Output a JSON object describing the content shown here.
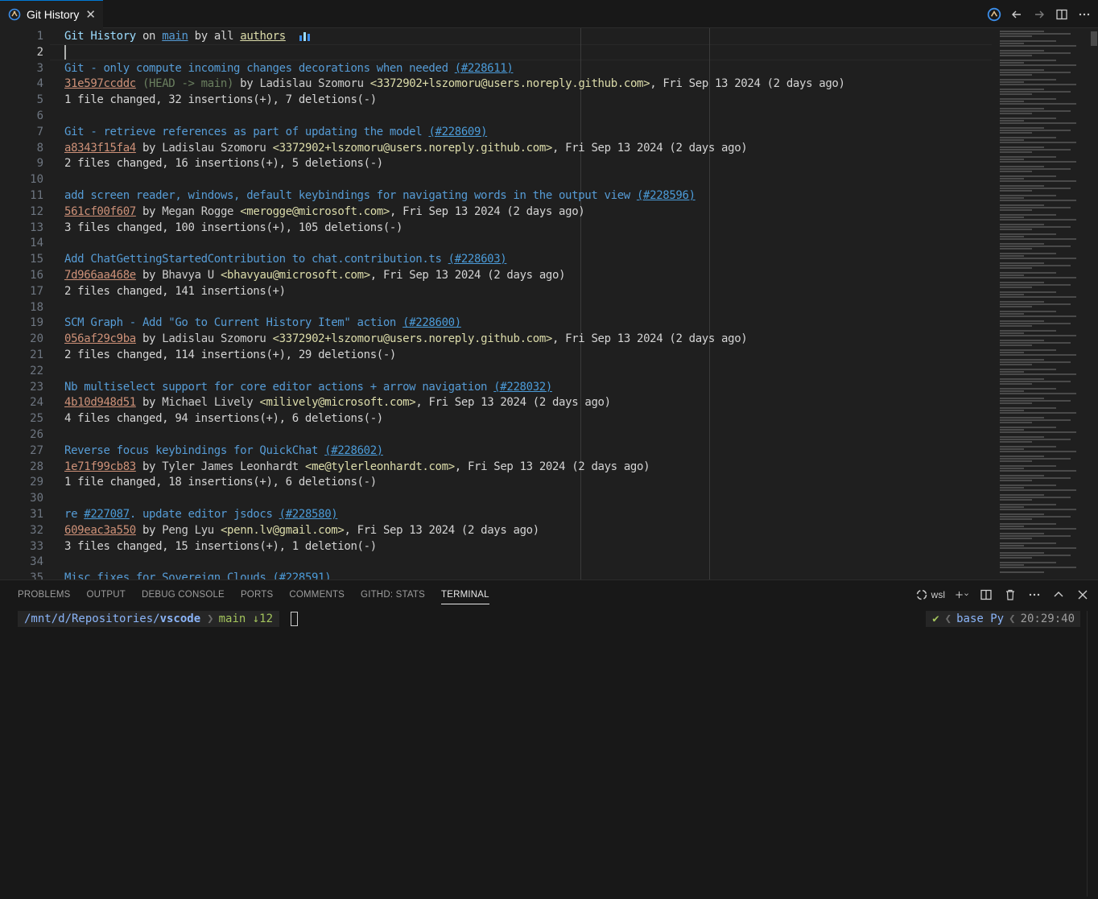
{
  "tab": {
    "title": "Git History",
    "close_glyph": "✕",
    "icon": "git-history-icon"
  },
  "editor": {
    "line_numbers": [
      "1",
      "2",
      "3",
      "4",
      "5",
      "6",
      "7",
      "8",
      "9",
      "10",
      "11",
      "12",
      "13",
      "14",
      "15",
      "16",
      "17",
      "18",
      "19",
      "20",
      "21",
      "22",
      "23",
      "24",
      "25",
      "26",
      "27",
      "28",
      "29",
      "30",
      "31",
      "32",
      "33",
      "34",
      "35"
    ],
    "header": {
      "prefix": "Git History",
      "on": "on",
      "branch": "main",
      "by": "by",
      "all": "all",
      "authors": "authors",
      "chart_icon": "bar-chart-icon"
    },
    "commits": [
      {
        "subject": "Git - only compute incoming changes decorations when needed",
        "pr": "(#228611)",
        "hash": "31e597ccddc",
        "refs": "(HEAD -> main)",
        "author": "Ladislau Szomoru",
        "email": "<3372902+lszomoru@users.noreply.github.com>",
        "date": ", Fri Sep 13 2024 (2 days ago)",
        "stats": "1 file changed, 32 insertions(+), 7 deletions(-)"
      },
      {
        "subject": "Git - retrieve references as part of updating the model",
        "pr": "(#228609)",
        "hash": "a8343f15fa4",
        "refs": "",
        "author": "Ladislau Szomoru",
        "email": "<3372902+lszomoru@users.noreply.github.com>",
        "date": ", Fri Sep 13 2024 (2 days ago)",
        "stats": "2 files changed, 16 insertions(+), 5 deletions(-)"
      },
      {
        "subject": "add screen reader, windows, default keybindings for navigating words in the output view",
        "pr": "(#228596)",
        "hash": "561cf00f607",
        "refs": "",
        "author": "Megan Rogge",
        "email": "<merogge@microsoft.com>",
        "date": ", Fri Sep 13 2024 (2 days ago)",
        "stats": "3 files changed, 100 insertions(+), 105 deletions(-)"
      },
      {
        "subject": "Add ChatGettingStartedContribution to chat.contribution.ts",
        "pr": "(#228603)",
        "hash": "7d966aa468e",
        "refs": "",
        "author": "Bhavya U",
        "email": "<bhavyau@microsoft.com>",
        "date": ", Fri Sep 13 2024 (2 days ago)",
        "stats": "2 files changed, 141 insertions(+)"
      },
      {
        "subject": "SCM Graph - Add \"Go to Current History Item\" action",
        "pr": "(#228600)",
        "hash": "056af29c9ba",
        "refs": "",
        "author": "Ladislau Szomoru",
        "email": "<3372902+lszomoru@users.noreply.github.com>",
        "date": ", Fri Sep 13 2024 (2 days ago)",
        "stats": "2 files changed, 114 insertions(+), 29 deletions(-)"
      },
      {
        "subject": "Nb multiselect support for core editor actions + arrow navigation",
        "pr": "(#228032)",
        "hash": "4b10d948d51",
        "refs": "",
        "author": "Michael Lively",
        "email": "<milively@microsoft.com>",
        "date": ", Fri Sep 13 2024 (2 days ago)",
        "stats": "4 files changed, 94 insertions(+), 6 deletions(-)"
      },
      {
        "subject": "Reverse focus keybindings for QuickChat",
        "pr": "(#228602)",
        "hash": "1e71f99cb83",
        "refs": "",
        "author": "Tyler James Leonhardt",
        "email": "<me@tylerleonhardt.com>",
        "date": ", Fri Sep 13 2024 (2 days ago)",
        "stats": "1 file changed, 18 insertions(+), 6 deletions(-)"
      },
      {
        "subject_pre": "re ",
        "subject_link": "#227087",
        "subject": ". update editor jsdocs",
        "pr": "(#228580)",
        "hash": "609eac3a550",
        "refs": "",
        "author": "Peng Lyu",
        "email": "<penn.lv@gmail.com>",
        "date": ", Fri Sep 13 2024 (2 days ago)",
        "stats": "3 files changed, 15 insertions(+), 1 deletion(-)"
      },
      {
        "subject": "Misc fixes for Sovereign Clouds",
        "pr": "(#228591)"
      }
    ],
    "by_word": "by"
  },
  "panel": {
    "tabs": [
      "PROBLEMS",
      "OUTPUT",
      "DEBUG CONSOLE",
      "PORTS",
      "COMMENTS",
      "GITHD: STATS",
      "TERMINAL"
    ],
    "active_tab": "TERMINAL",
    "terminal_name": "wsl",
    "prompt": {
      "path_prefix": "/mnt/d/Repositories/",
      "path_dir": "vscode",
      "branch": "main ↓12",
      "status": "✔",
      "env": "base Py",
      "time": "20:29:40"
    }
  }
}
